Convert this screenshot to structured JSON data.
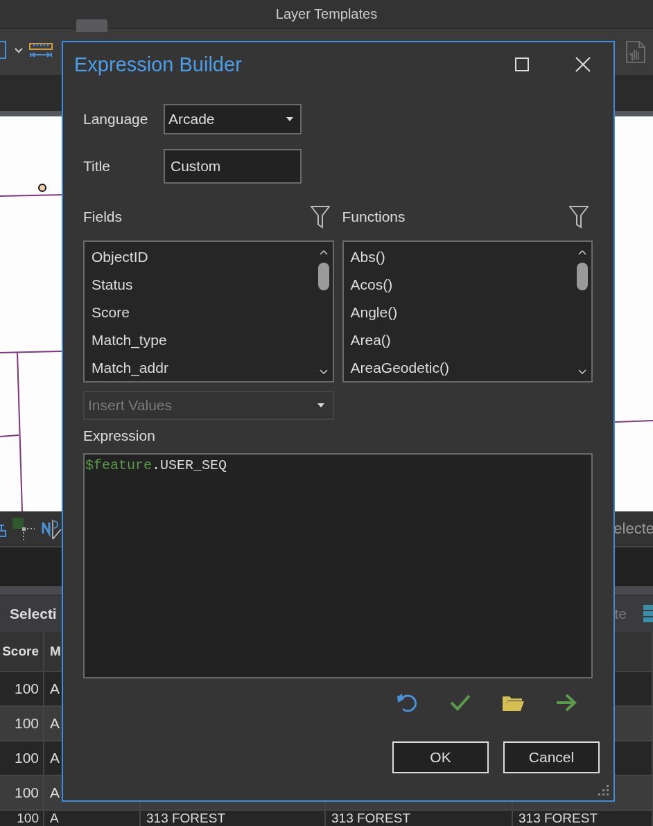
{
  "app": {
    "title": "Layer Templates"
  },
  "background": {
    "tool_strip_text": "electe",
    "panel_title": "Selecti",
    "panel_button": "te",
    "table": {
      "columns": [
        "Score",
        "M"
      ],
      "rows": [
        {
          "cells": [
            "100",
            "A"
          ]
        },
        {
          "cells": [
            "100",
            "A"
          ]
        },
        {
          "cells": [
            "100",
            "A"
          ]
        },
        {
          "cells": [
            "100",
            "A"
          ]
        },
        {
          "cells": [
            "100",
            "A",
            "313 FOREST",
            "313 FOREST",
            "313 FOREST"
          ]
        }
      ]
    }
  },
  "dialog": {
    "title": "Expression Builder",
    "language": {
      "label": "Language",
      "value": "Arcade"
    },
    "title_field": {
      "label": "Title",
      "value": "Custom"
    },
    "fields": {
      "label": "Fields",
      "items": [
        "ObjectID",
        "Status",
        "Score",
        "Match_type",
        "Match_addr"
      ]
    },
    "functions": {
      "label": "Functions",
      "items": [
        "Abs()",
        "Acos()",
        "Angle()",
        "Area()",
        "AreaGeodetic()"
      ]
    },
    "insert_values": {
      "placeholder": "Insert Values",
      "disabled": true
    },
    "expression": {
      "label": "Expression",
      "tokens": [
        {
          "text": "$feature",
          "kind": "global"
        },
        {
          "text": ".USER_SEQ",
          "kind": "member"
        }
      ]
    },
    "buttons": [
      {
        "label": "OK"
      },
      {
        "label": "Cancel"
      }
    ]
  }
}
